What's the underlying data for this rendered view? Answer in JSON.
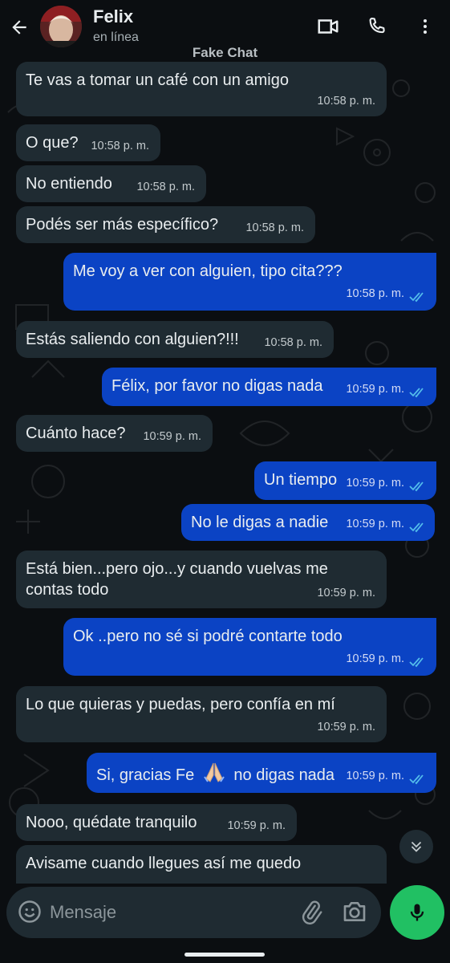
{
  "header": {
    "contact_name": "Felix",
    "status": "en línea",
    "chat_label": "Fake Chat"
  },
  "messages": [
    {
      "dir": "in",
      "text": "Te vas a tomar un café con un amigo",
      "time": "10:58 p. m."
    },
    {
      "dir": "in",
      "text": "O que?",
      "time": "10:58 p. m."
    },
    {
      "dir": "in",
      "text": "No entiendo",
      "time": "10:58 p. m."
    },
    {
      "dir": "in",
      "text": "Podés ser más específico?",
      "time": "10:58 p. m."
    },
    {
      "dir": "out",
      "text": "Me voy a ver con alguien, tipo cita???",
      "time": "10:58 p. m."
    },
    {
      "dir": "in",
      "text": "Estás saliendo con alguien?!!!",
      "time": "10:58 p. m."
    },
    {
      "dir": "out",
      "text": "Félix, por favor no digas nada",
      "time": "10:59 p. m."
    },
    {
      "dir": "in",
      "text": "Cuánto hace?",
      "time": "10:59 p. m."
    },
    {
      "dir": "out",
      "text": "Un tiempo",
      "time": "10:59 p. m."
    },
    {
      "dir": "out",
      "text": "No le digas a nadie",
      "time": "10:59 p. m."
    },
    {
      "dir": "in",
      "text_line1": "Está bien...pero ojo...y cuando vuelvas me",
      "text_line2": "contas todo",
      "time": "10:59 p. m."
    },
    {
      "dir": "out",
      "text": "Ok ..pero no sé si podré contarte todo",
      "time": "10:59 p. m."
    },
    {
      "dir": "in",
      "text": "Lo que quieras y puedas, pero confía en mí",
      "time": "10:59 p. m."
    },
    {
      "dir": "out",
      "text_before": "Si, gracias Fe",
      "emoji": "🙏",
      "text_after": "no digas nada",
      "time": "10:59 p. m."
    },
    {
      "dir": "in",
      "text": "Nooo, quédate tranquilo",
      "time": "10:59 p. m."
    },
    {
      "dir": "in",
      "text": "Avisame cuando llegues así me quedo",
      "time": ""
    }
  ],
  "composer": {
    "placeholder": "Mensaje"
  },
  "colors": {
    "background": "#0b0e11",
    "incoming_bubble": "#1f2b32",
    "outgoing_bubble": "#0b43c4",
    "read_ticks": "#53bdeb",
    "mic_button": "#21c063"
  },
  "icons": {
    "back": "arrow-left-icon",
    "video": "video-call-icon",
    "call": "phone-icon",
    "menu": "more-vertical-icon",
    "scroll": "double-chevron-down-icon",
    "emoji": "emoji-icon",
    "attach": "paperclip-icon",
    "camera": "camera-icon",
    "mic": "mic-icon",
    "read": "double-check-icon"
  }
}
